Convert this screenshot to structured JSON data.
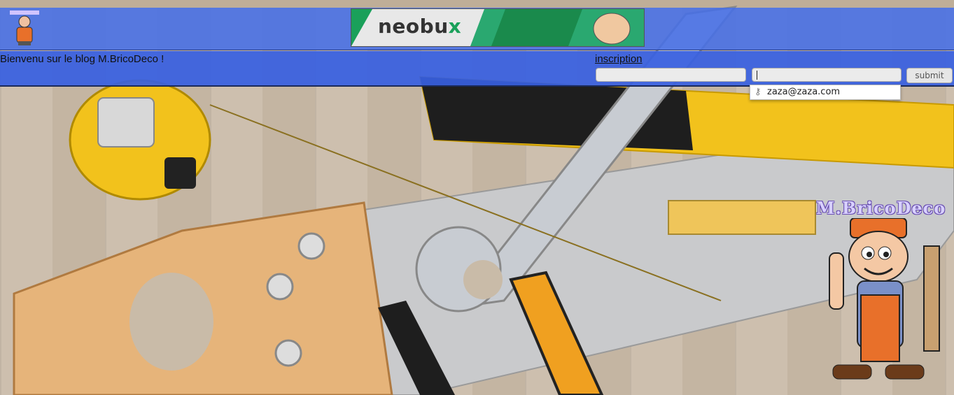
{
  "header": {
    "ad_banner": {
      "text": "neobu",
      "text_accent": "x"
    }
  },
  "subheader": {
    "welcome": "Bienvenu sur le blog M.BricoDeco !",
    "signup_link": "inscription"
  },
  "login_form": {
    "field1_value": "",
    "field2_value": "",
    "submit_label": "submit"
  },
  "autocomplete": {
    "items": [
      {
        "label": "zaza@zaza.com",
        "icon": "key-icon"
      }
    ]
  },
  "mascot": {
    "title": "M.BricoDeco"
  },
  "colors": {
    "header_bar": "#4a6fe6",
    "subheader_bar": "#3a62e0",
    "wood": "#cdbfae",
    "tool_yellow": "#f0c020"
  }
}
